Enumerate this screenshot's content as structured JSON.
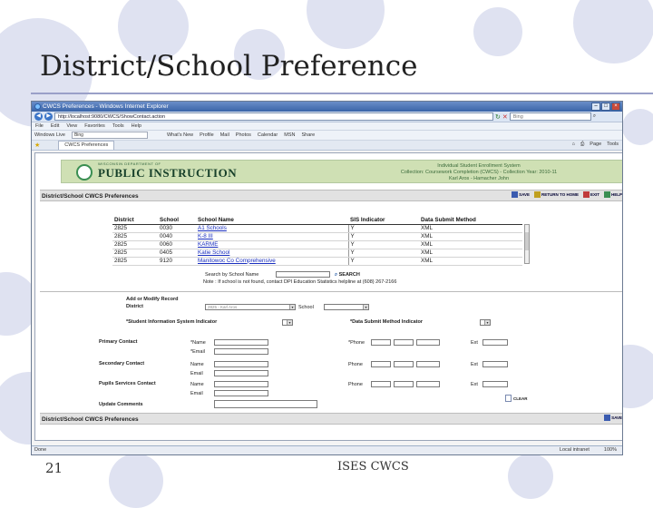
{
  "slide": {
    "title": "District/School Preference",
    "number": "21",
    "footer": "ISES CWCS"
  },
  "browser": {
    "title": "CWCS Preferences - Windows Internet Explorer",
    "url": "http://localhost:9080/CWCS/ShowContact.action",
    "search_placeholder": "Bing",
    "menu": [
      "File",
      "Edit",
      "View",
      "Favorites",
      "Tools",
      "Help"
    ],
    "links_bar": {
      "windows_live": "Windows Live",
      "search_value": "Bing",
      "items": [
        "What's New",
        "Profile",
        "Mail",
        "Photos",
        "Calendar",
        "MSN",
        "Share"
      ]
    },
    "tab_label": "CWCS Preferences",
    "tools": [
      "Page",
      "Tools"
    ],
    "status_left": "Done",
    "status_zone": "Local intranet",
    "zoom": "100%"
  },
  "banner": {
    "logo_small": "WISCONSIN DEPARTMENT OF",
    "logo_main": "PUBLIC INSTRUCTION",
    "line1": "Individual Student Enrollment System",
    "line2": "Collection: Coursework Completion (CWCS) - Collection Year: 2010-11",
    "line3": "Karl Aros - Hamacher John"
  },
  "header": {
    "title": "District/School CWCS Preferences",
    "save": "SAVE",
    "return": "RETURN TO HOME",
    "exit": "EXIT",
    "help": "HELP"
  },
  "table": {
    "columns": [
      "District",
      "School",
      "School Name",
      "SIS Indicator",
      "Data Submit Method"
    ],
    "rows": [
      [
        "2825",
        "0030",
        "A1 Schools",
        "Y",
        "XML"
      ],
      [
        "2825",
        "0040",
        "K-8 III",
        "Y",
        "XML"
      ],
      [
        "2825",
        "0060",
        "KARME",
        "Y",
        "XML"
      ],
      [
        "2825",
        "0405",
        "Katie School",
        "Y",
        "XML"
      ],
      [
        "2825",
        "9120",
        "Manitowoc Co Comprehensive",
        "Y",
        "XML"
      ]
    ]
  },
  "search": {
    "label": "Search by School Name",
    "button": "SEARCH",
    "note": "Note : If school is not found, contact DPI Education Statistics helpline at (608) 267-2166"
  },
  "form": {
    "add_modify": "Add or Modify Record",
    "district_label": "District",
    "district_value": "2825 - Karl Aros",
    "school_label": "School",
    "sis_label": "*Student Information System Indicator",
    "dsm_label": "*Data Submit Method Indicator",
    "primary": "Primary Contact",
    "secondary": "Secondary Contact",
    "pupils": "Pupils Services Contact",
    "update": "Update Comments",
    "name_req": "*Name",
    "email_req": "*Email",
    "name": "Name",
    "email": "Email",
    "phone_req": "*Phone",
    "phone": "Phone",
    "ext": "Ext",
    "clear": "CLEAR"
  },
  "footer_bar": {
    "title": "District/School CWCS Preferences",
    "save": "SAVE"
  }
}
